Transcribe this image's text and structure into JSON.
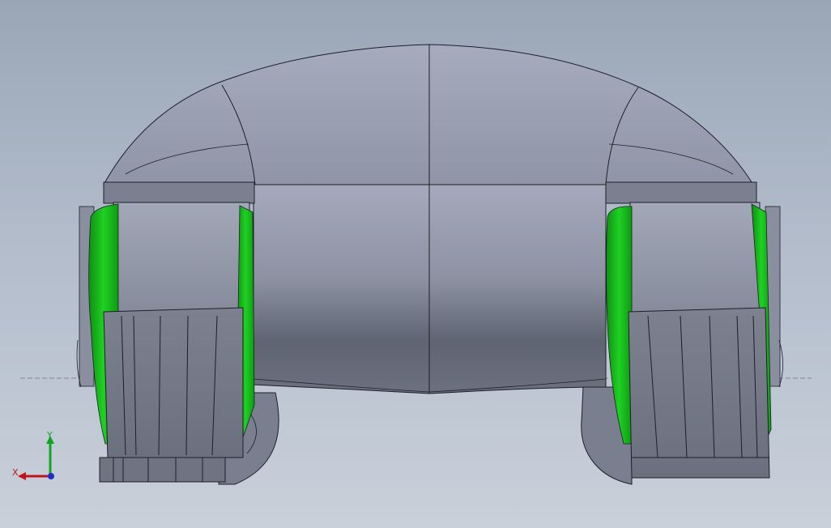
{
  "viewport": {
    "background_top": "#9aa6b6",
    "background_bottom": "#c9d0da"
  },
  "model": {
    "body_color": "#8f95a6",
    "body_shadow": "#5f6473",
    "tread_color": "#7d8290",
    "green_band_color": "#17c51a",
    "edge_color": "#1e1f26"
  },
  "triad": {
    "x_label": "X",
    "y_label": "Y",
    "x_color": "#c0141a",
    "y_color": "#10a520",
    "z_color": "#1e2ec8"
  }
}
